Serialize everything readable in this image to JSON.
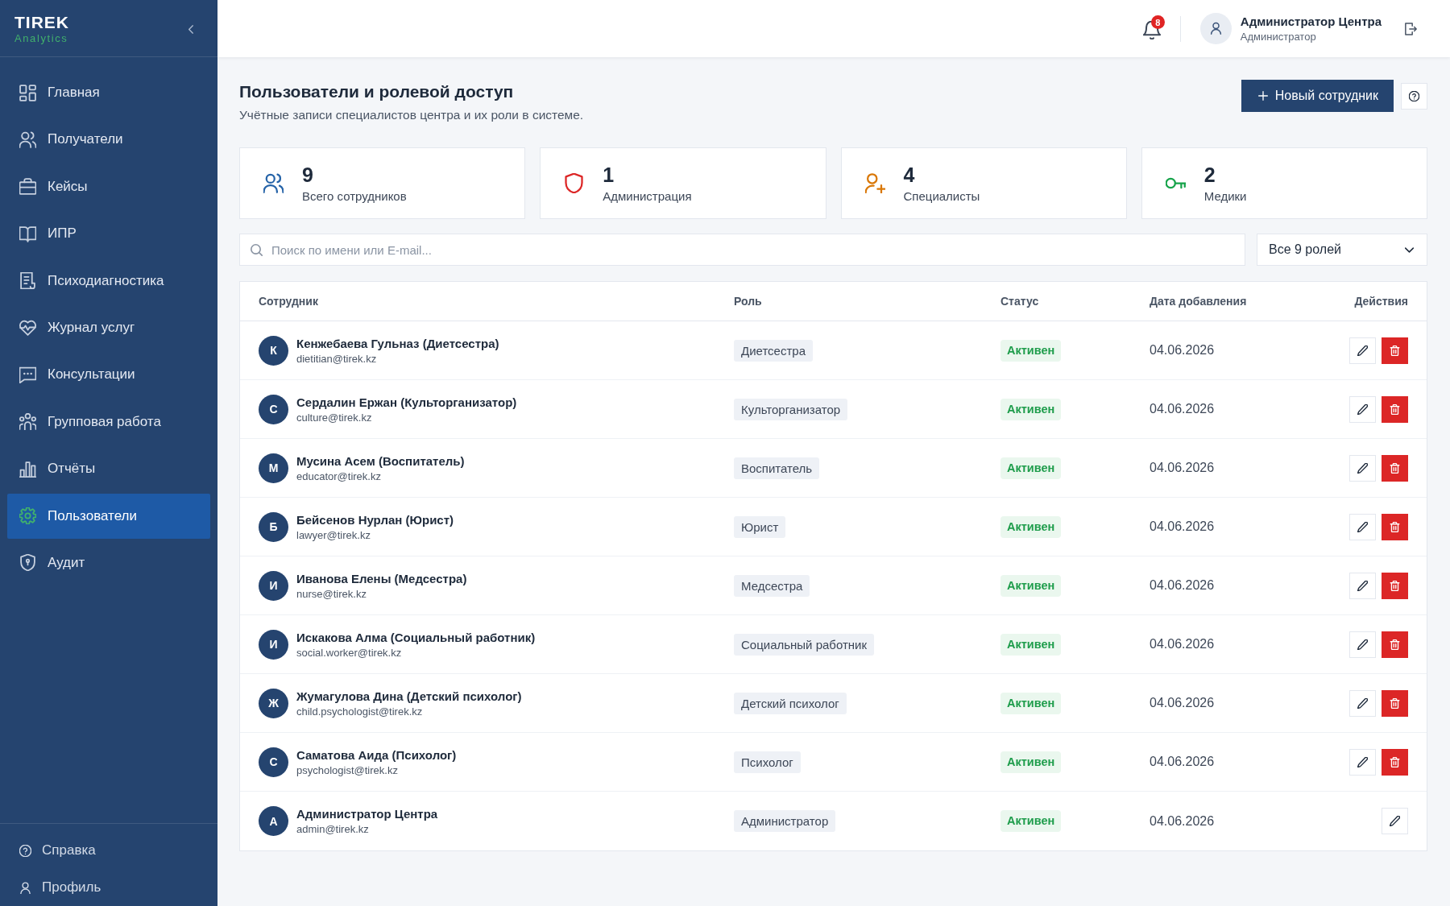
{
  "sidebar": {
    "logo": {
      "title": "TIREK",
      "subtitle": "Analytics"
    },
    "items": [
      {
        "label": "Главная",
        "selected": false
      },
      {
        "label": "Получатели",
        "selected": false
      },
      {
        "label": "Кейсы",
        "selected": false
      },
      {
        "label": "ИПР",
        "selected": false
      },
      {
        "label": "Психодиагностика",
        "selected": false
      },
      {
        "label": "Журнал услуг",
        "selected": false
      },
      {
        "label": "Консультации",
        "selected": false
      },
      {
        "label": "Групповая работа",
        "selected": false
      },
      {
        "label": "Отчёты",
        "selected": false
      },
      {
        "label": "Пользователи",
        "selected": true
      },
      {
        "label": "Аудит",
        "selected": false
      }
    ],
    "footer_items": [
      {
        "label": "Справка"
      },
      {
        "label": "Профиль"
      }
    ]
  },
  "header": {
    "notifications_count": "8",
    "user": {
      "name": "Администратор Центра",
      "role": "Администратор"
    }
  },
  "page": {
    "title": "Пользователи и ролевой доступ",
    "subtitle": "Учётные записи специалистов центра и их роли в системе.",
    "primary_button": "Новый сотрудник"
  },
  "stats": [
    {
      "value": "9",
      "label": "Всего сотрудников",
      "color": "#2563a8"
    },
    {
      "value": "1",
      "label": "Администрация",
      "color": "#dc2626"
    },
    {
      "value": "4",
      "label": "Специалисты",
      "color": "#d97706"
    },
    {
      "value": "2",
      "label": "Медики",
      "color": "#16a34a"
    }
  ],
  "filters": {
    "search": {
      "placeholder": "Поиск по имени или E-mail..."
    },
    "role_select": {
      "value": "Все 9 ролей"
    }
  },
  "table": {
    "columns": [
      "Сотрудник",
      "Роль",
      "Статус",
      "Дата добавления",
      "Действия"
    ],
    "rows": [
      {
        "initial": "К",
        "name": "Кенжебаева Гульназ (Диетсестра)",
        "email": "dietitian@tirek.kz",
        "role": "Диетсестра",
        "status": "Активен",
        "date": "04.06.2026",
        "actions": [
          {
            "kind": "edit"
          },
          {
            "kind": "delete"
          }
        ]
      },
      {
        "initial": "С",
        "name": "Сердалин Ержан (Культорганизатор)",
        "email": "culture@tirek.kz",
        "role": "Культорганизатор",
        "status": "Активен",
        "date": "04.06.2026",
        "actions": [
          {
            "kind": "edit"
          },
          {
            "kind": "delete"
          }
        ]
      },
      {
        "initial": "М",
        "name": "Мусина Асем (Воспитатель)",
        "email": "educator@tirek.kz",
        "role": "Воспитатель",
        "status": "Активен",
        "date": "04.06.2026",
        "actions": [
          {
            "kind": "edit"
          },
          {
            "kind": "delete"
          }
        ]
      },
      {
        "initial": "Б",
        "name": "Бейсенов Нурлан (Юрист)",
        "email": "lawyer@tirek.kz",
        "role": "Юрист",
        "status": "Активен",
        "date": "04.06.2026",
        "actions": [
          {
            "kind": "edit"
          },
          {
            "kind": "delete"
          }
        ]
      },
      {
        "initial": "И",
        "name": "Иванова Елены (Медсестра)",
        "email": "nurse@tirek.kz",
        "role": "Медсестра",
        "status": "Активен",
        "date": "04.06.2026",
        "actions": [
          {
            "kind": "edit"
          },
          {
            "kind": "delete"
          }
        ]
      },
      {
        "initial": "И",
        "name": "Искакова Алма (Социальный работник)",
        "email": "social.worker@tirek.kz",
        "role": "Социальный работник",
        "status": "Активен",
        "date": "04.06.2026",
        "actions": [
          {
            "kind": "edit"
          },
          {
            "kind": "delete"
          }
        ]
      },
      {
        "initial": "Ж",
        "name": "Жумагулова Дина (Детский психолог)",
        "email": "child.psychologist@tirek.kz",
        "role": "Детский психолог",
        "status": "Активен",
        "date": "04.06.2026",
        "actions": [
          {
            "kind": "edit"
          },
          {
            "kind": "delete"
          }
        ]
      },
      {
        "initial": "С",
        "name": "Саматова Аида (Психолог)",
        "email": "psychologist@tirek.kz",
        "role": "Психолог",
        "status": "Активен",
        "date": "04.06.2026",
        "actions": [
          {
            "kind": "edit"
          },
          {
            "kind": "delete"
          }
        ]
      },
      {
        "initial": "А",
        "name": "Администратор Центра",
        "email": "admin@tirek.kz",
        "role": "Администратор",
        "status": "Активен",
        "date": "04.06.2026",
        "actions": [
          {
            "kind": "edit"
          }
        ]
      }
    ]
  }
}
